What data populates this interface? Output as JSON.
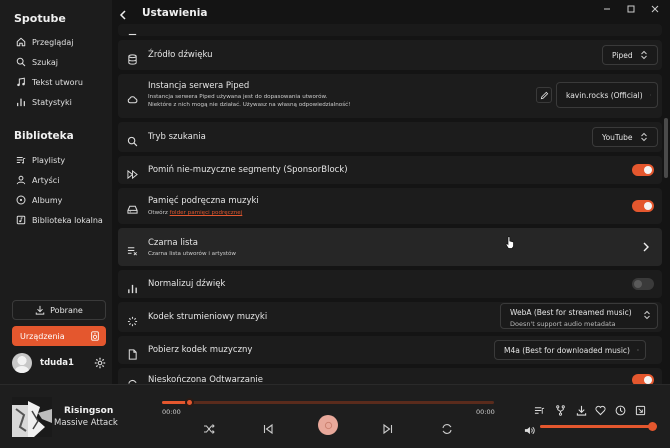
{
  "app": {
    "title": "Spotube"
  },
  "sidebar": {
    "nav": [
      {
        "label": "Przeglądaj",
        "icon": "home-icon"
      },
      {
        "label": "Szukaj",
        "icon": "search-icon"
      },
      {
        "label": "Tekst utworu",
        "icon": "music-note-icon"
      },
      {
        "label": "Statystyki",
        "icon": "bar-chart-icon"
      }
    ],
    "library_title": "Biblioteka",
    "library": [
      {
        "label": "Playlisty",
        "icon": "playlist-icon"
      },
      {
        "label": "Artyści",
        "icon": "user-icon"
      },
      {
        "label": "Albumy",
        "icon": "disc-icon"
      },
      {
        "label": "Biblioteka lokalna",
        "icon": "folder-music-icon"
      }
    ],
    "downloads_label": "Pobrane",
    "devices_label": "Urządzenia",
    "username": "tduda1"
  },
  "header": {
    "title": "Ustawienia"
  },
  "settings": {
    "audio_source": {
      "title": "Źródło dźwięku",
      "value": "Piped",
      "icon": "database-icon"
    },
    "piped": {
      "title": "Instancja serwera Piped",
      "sub1": "Instancja serwera Piped używana jest do dopasowania utworów.",
      "sub2": "Niektóre z nich mogą nie działać. Używasz na własną odpowiedzialność!",
      "value": "kavin.rocks (Official)",
      "icon": "cloud-icon"
    },
    "search_mode": {
      "title": "Tryb szukania",
      "value": "YouTube",
      "icon": "search-icon"
    },
    "sponsorblock": {
      "title": "Pomiń nie-muzyczne segmenty (SponsorBlock)",
      "enabled": true,
      "icon": "skip-forward-icon"
    },
    "cache": {
      "title": "Pamięć podręczna muzyki",
      "sub_prefix": "Otwórz",
      "sub_link": "folder pamięci podręcznej",
      "enabled": true,
      "icon": "hard-drive-icon"
    },
    "blacklist": {
      "title": "Czarna lista",
      "sub": "Czarna lista utworów i artystów",
      "icon": "playlist-remove-icon"
    },
    "normalize": {
      "title": "Normalizuj dźwięk",
      "enabled": false,
      "icon": "bar-chart-icon"
    },
    "stream_codec": {
      "title": "Kodek strumieniowy muzyki",
      "value": "WebA (Best for streamed music)",
      "value_extra": "Doesn't support audio metadata",
      "icon": "loader-icon"
    },
    "download_codec": {
      "title": "Pobierz kodek muzyczny",
      "value": "M4a (Best for downloaded music)",
      "icon": "file-icon"
    },
    "endless": {
      "title": "Nieskończona Odtwarzanie",
      "enabled": true,
      "icon": "repeat-icon"
    }
  },
  "player": {
    "track_title": "Risingson",
    "artist": "Massive Attack",
    "elapsed": "00:00",
    "duration": "00:00",
    "progress": 0.08,
    "volume": 1.0
  },
  "colors": {
    "accent": "#e4572e",
    "background": "#141414",
    "panel": "#1c1c1c"
  }
}
